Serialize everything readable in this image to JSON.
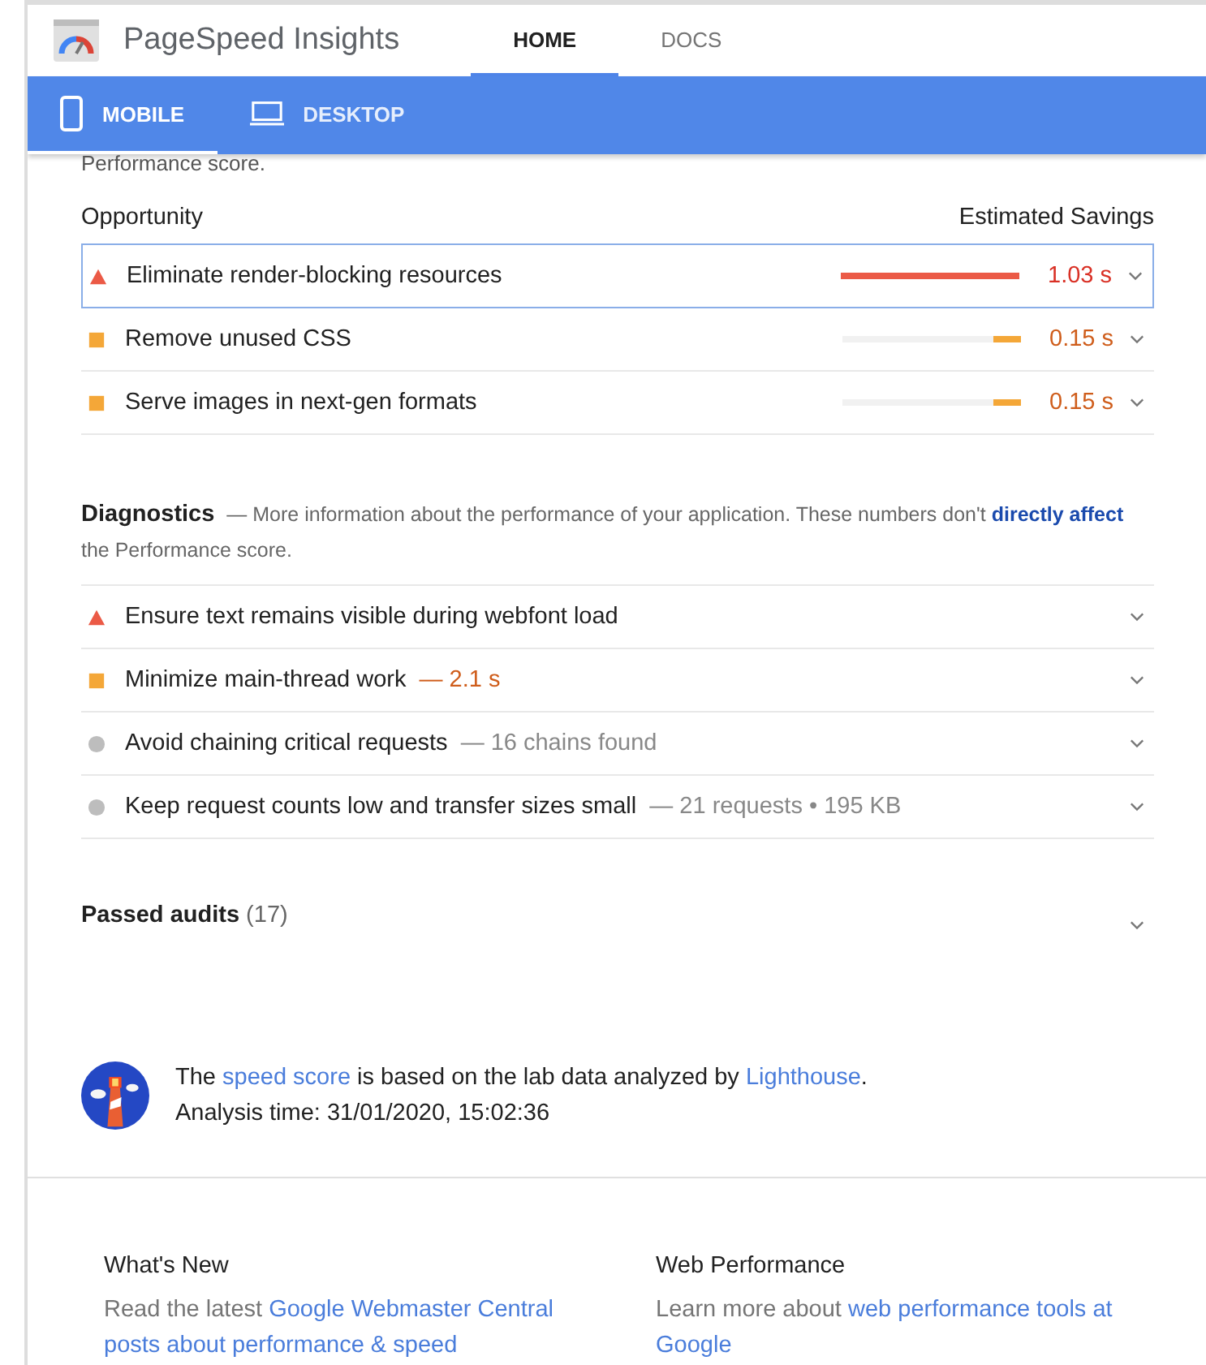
{
  "header": {
    "title": "PageSpeed Insights",
    "nav": [
      {
        "label": "HOME",
        "selected": true
      },
      {
        "label": "DOCS",
        "selected": false
      }
    ]
  },
  "device_tabs": [
    {
      "kind": "mobile",
      "label": "MOBILE",
      "selected": true
    },
    {
      "kind": "desktop",
      "label": "DESKTOP",
      "selected": false
    }
  ],
  "cut_text": "Performance score.",
  "opportunity": {
    "heading": "Opportunity",
    "savings_heading": "Estimated Savings",
    "items": [
      {
        "kind": "fail",
        "title": "Eliminate render-blocking resources",
        "savings": "1.03 s",
        "level": 1,
        "selected": true
      },
      {
        "kind": "average",
        "title": "Remove unused CSS",
        "savings": "0.15 s",
        "level": 0.15,
        "selected": false
      },
      {
        "kind": "average",
        "title": "Serve images in next-gen formats",
        "savings": "0.15 s",
        "level": 0.15,
        "selected": false
      }
    ]
  },
  "diagnostics": {
    "title": "Diagnostics",
    "description": [
      {
        "text": "— More information about the performance of your application. These numbers don't "
      },
      {
        "link": "directly affect"
      },
      {
        "text": " the Performance score."
      }
    ],
    "items": [
      {
        "kind": "fail",
        "title": "Ensure text remains visible during webfont load"
      },
      {
        "kind": "average",
        "title": "Minimize main-thread work",
        "detail": "— 2.1 s"
      },
      {
        "kind": "info",
        "title": "Avoid chaining critical requests",
        "detail": "— 16 chains found"
      },
      {
        "kind": "info",
        "title": "Keep request counts low and transfer sizes small",
        "detail": "— 21 requests • 195 KB"
      }
    ]
  },
  "passed_audits": {
    "label": "Passed audits",
    "count": "(17)"
  },
  "note": {
    "sentence": [
      {
        "text": "The "
      },
      {
        "link": "speed score"
      },
      {
        "text": " is based on the lab data analyzed by "
      },
      {
        "link": "Lighthouse"
      },
      {
        "text": "."
      }
    ],
    "analysis_time": "Analysis time: 31/01/2020, 15:02:36"
  },
  "footer": [
    {
      "title": "What's New",
      "text": [
        {
          "text": "Read the latest "
        },
        {
          "links": [
            "Google Webmaster Central",
            "posts about performance & speed"
          ]
        }
      ]
    },
    {
      "title": "Web Performance",
      "text": [
        {
          "text": "Learn more about "
        },
        {
          "links": [
            "web performance tools at",
            "Google"
          ]
        }
      ]
    }
  ]
}
